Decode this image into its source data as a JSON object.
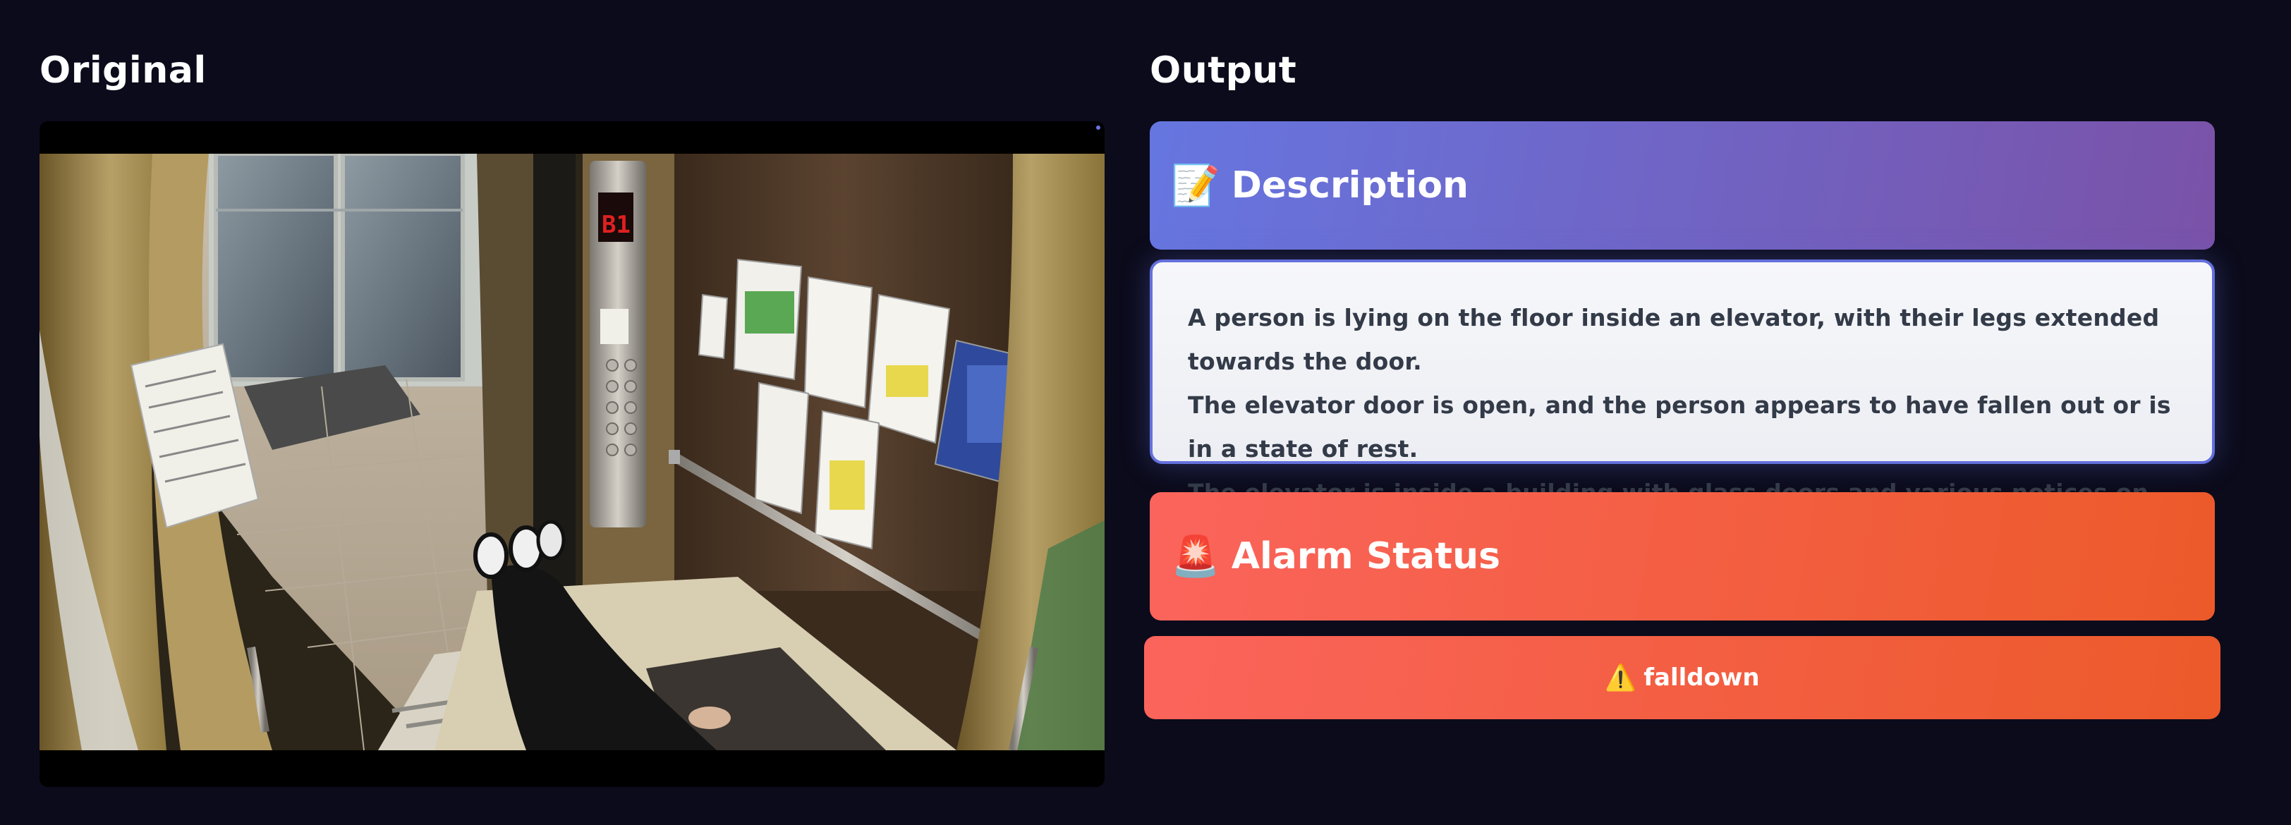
{
  "columns": {
    "original_title": "Original",
    "output_title": "Output"
  },
  "original": {
    "frame_overlay": {
      "floor_label": "B1"
    }
  },
  "output": {
    "description": {
      "icon": "memo-icon",
      "emoji": "📝",
      "title": "Description",
      "lines": [
        "A person is lying on the floor inside an elevator, with their legs extended towards the door.",
        "The elevator door is open, and the person appears to have fallen out or is in a state of rest.",
        "The elevator is inside a building with glass doors and various notices on the walls."
      ]
    },
    "alarm": {
      "icon": "siren-icon",
      "emoji": "🚨",
      "title": "Alarm Status",
      "status_icon": "warning-icon",
      "status_emoji": "⚠️",
      "status": "falldown"
    }
  },
  "colors": {
    "background": "#0b0b1b",
    "description_gradient": [
      "#6676e0",
      "#7a52a8"
    ],
    "alarm_gradient": [
      "#fb645c",
      "#ec5a2a"
    ],
    "description_border": "#6470dc"
  }
}
